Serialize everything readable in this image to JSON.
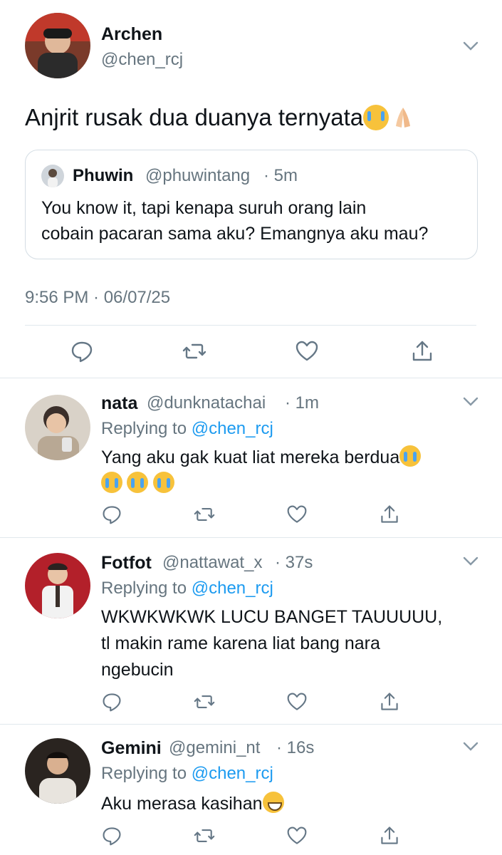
{
  "main_tweet": {
    "author_name": "Archen",
    "author_handle": "@chen_rcj",
    "text": "Anjrit rusak dua duanya ternyata",
    "timestamp": "9:56 PM · 06/07/25",
    "quoted": {
      "author_name": "Phuwin",
      "author_handle": "@phuwintang",
      "age": "· 5m",
      "text_line1": "You know it, tapi kenapa suruh orang lain",
      "text_line2": "cobain pacaran sama aku? Emangnya aku mau?"
    }
  },
  "replies": [
    {
      "author_name": "nata",
      "author_handle": "@dunknatachai",
      "age": "· 1m",
      "replying_prefix": "Replying to",
      "replying_handle": "@chen_rcj",
      "text": "Yang aku gak kuat liat mereka berdua"
    },
    {
      "author_name": "Fotfot",
      "author_handle": "@nattawat_x",
      "age": "· 37s",
      "replying_prefix": "Replying to",
      "replying_handle": "@chen_rcj",
      "text_line1": "WKWKWKWK LUCU BANGET TAUUUUU,",
      "text_line2": "tl makin rame karena liat bang nara",
      "text_line3": "ngebucin"
    },
    {
      "author_name": "Gemini",
      "author_handle": "@gemini_nt",
      "age": "· 16s",
      "replying_prefix": "Replying to",
      "replying_handle": "@chen_rcj",
      "text": "Aku merasa kasihan"
    }
  ],
  "icons": [
    "chevron-down-icon",
    "reply-icon",
    "retweet-icon",
    "like-icon",
    "share-icon",
    "loudly-crying-face-emoji",
    "folded-hands-emoji",
    "grinning-face-emoji"
  ],
  "colors": {
    "text": "#0f1419",
    "muted": "#66757f",
    "link": "#1d9bf0",
    "divider": "#e1e8ed"
  }
}
